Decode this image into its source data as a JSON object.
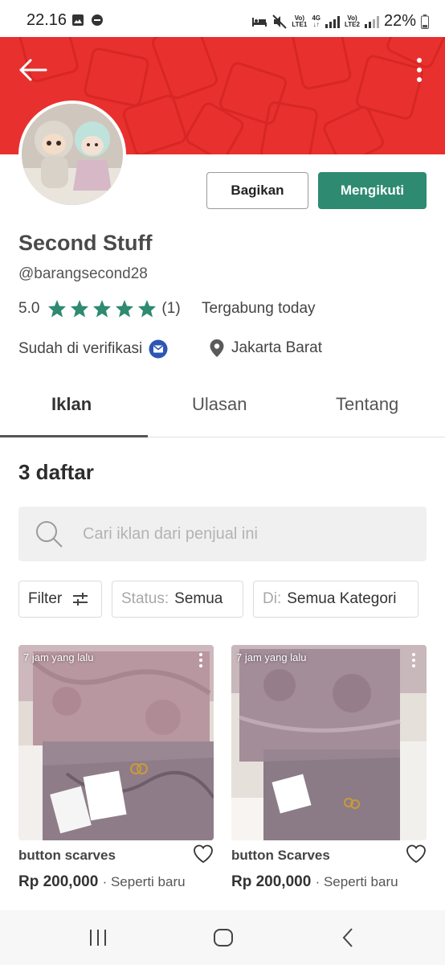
{
  "status_bar": {
    "time": "22.16",
    "battery": "22%",
    "sim1_top": "Vo)",
    "sim1_bottom": "LTE1",
    "network_top": "4G",
    "sim2_top": "Vo)",
    "sim2_bottom": "LTE2"
  },
  "header": {
    "back_icon": "arrow-left-icon",
    "more_icon": "more-vertical-icon",
    "banner_color": "#e8312f"
  },
  "profile": {
    "share_label": "Bagikan",
    "follow_label": "Mengikuti",
    "name": "Second Stuff",
    "handle": "@barangsecond28",
    "rating": "5.0",
    "rating_count": "(1)",
    "stars": 5,
    "joined": "Tergabung today",
    "verified_label": "Sudah di verifikasi",
    "location": "Jakarta Barat",
    "accent_color": "#2e8a71"
  },
  "tabs": [
    {
      "label": "Iklan"
    },
    {
      "label": "Ulasan"
    },
    {
      "label": "Tentang"
    }
  ],
  "listings_header": {
    "count_label": "3 daftar",
    "search_placeholder": "Cari iklan dari penjual ini"
  },
  "filters": {
    "filter_label": "Filter",
    "status_prefix": "Status:",
    "status_value": "Semua",
    "location_prefix": "Di:",
    "location_value": "Semua Kategori"
  },
  "listings": [
    {
      "time": "7 jam yang lalu",
      "title": "button scarves",
      "price": "Rp 200,000",
      "condition": "· Seperti baru"
    },
    {
      "time": "7 jam yang lalu",
      "title": "button Scarves",
      "price": "Rp 200,000",
      "condition": "· Seperti baru"
    }
  ]
}
